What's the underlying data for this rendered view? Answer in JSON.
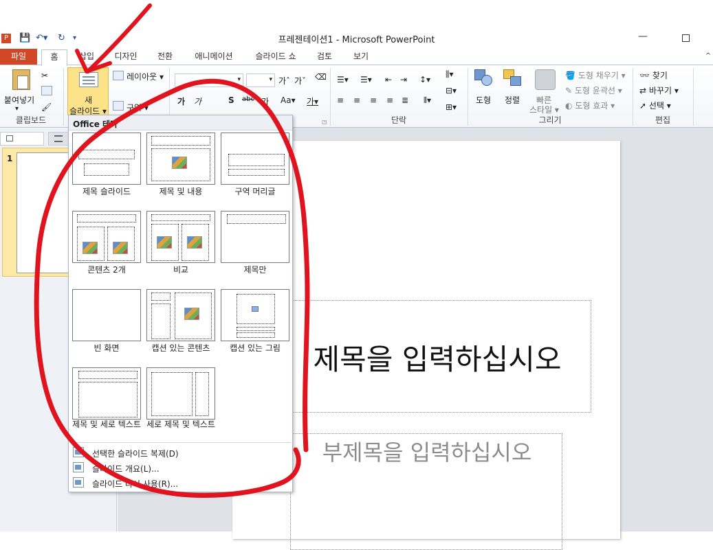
{
  "window": {
    "title": "프레젠테이션1 - Microsoft PowerPoint"
  },
  "tabs": [
    {
      "label": "파일"
    },
    {
      "label": "홈"
    },
    {
      "label": "삽입"
    },
    {
      "label": "디자인"
    },
    {
      "label": "전환"
    },
    {
      "label": "애니메이션"
    },
    {
      "label": "슬라이드 쇼"
    },
    {
      "label": "검토"
    },
    {
      "label": "보기"
    }
  ],
  "ribbon": {
    "clipboard": {
      "paste": "붙여넣기",
      "group": "클립보드"
    },
    "slides": {
      "new_slide_line1": "새",
      "new_slide_line2": "슬라이드 ▾",
      "layout": "레이아웃 ▾",
      "section": "구역 ▾"
    },
    "paragraph": {
      "group": "단락"
    },
    "drawing": {
      "shapes": "도형",
      "arrange": "정렬",
      "quick_styles_1": "빠른",
      "quick_styles_2": "스타일 ▾",
      "shape_fill": "도형 채우기 ▾",
      "shape_outline": "도형 윤곽선 ▾",
      "shape_effects": "도형 효과 ▾",
      "group": "그리기"
    },
    "editing": {
      "find": "찾기",
      "replace": "바꾸기 ▾",
      "select": "선택 ▾",
      "group": "편집"
    },
    "font_buttons": [
      "가",
      "가",
      "S",
      "abc",
      "가",
      "Aa▾",
      "가▾"
    ]
  },
  "slide_panel": {
    "slide_number": "1"
  },
  "layout_gallery": {
    "header": "Office 테마",
    "layouts": [
      {
        "name": "제목 슬라이드"
      },
      {
        "name": "제목 및 내용"
      },
      {
        "name": "구역 머리글"
      },
      {
        "name": "콘텐츠 2개"
      },
      {
        "name": "비교"
      },
      {
        "name": "제목만"
      },
      {
        "name": "빈 화면"
      },
      {
        "name": "캡션 있는 콘텐츠"
      },
      {
        "name": "캡션 있는 그림"
      },
      {
        "name": "제목 및 세로 텍스트"
      },
      {
        "name": "세로 제목 및 텍스트"
      }
    ],
    "actions": [
      {
        "label": "선택한 슬라이드 복제(D)"
      },
      {
        "label": "슬라이드 개요(L)..."
      },
      {
        "label": "슬라이드 다시 사용(R)..."
      }
    ]
  },
  "slide": {
    "title_placeholder": "제목을 입력하십시오",
    "subtitle_placeholder": "부제목을 입력하십시오"
  },
  "colors": {
    "file_tab": "#d24726",
    "annotation": "#e0141e",
    "selected_button": "#fce38a"
  }
}
